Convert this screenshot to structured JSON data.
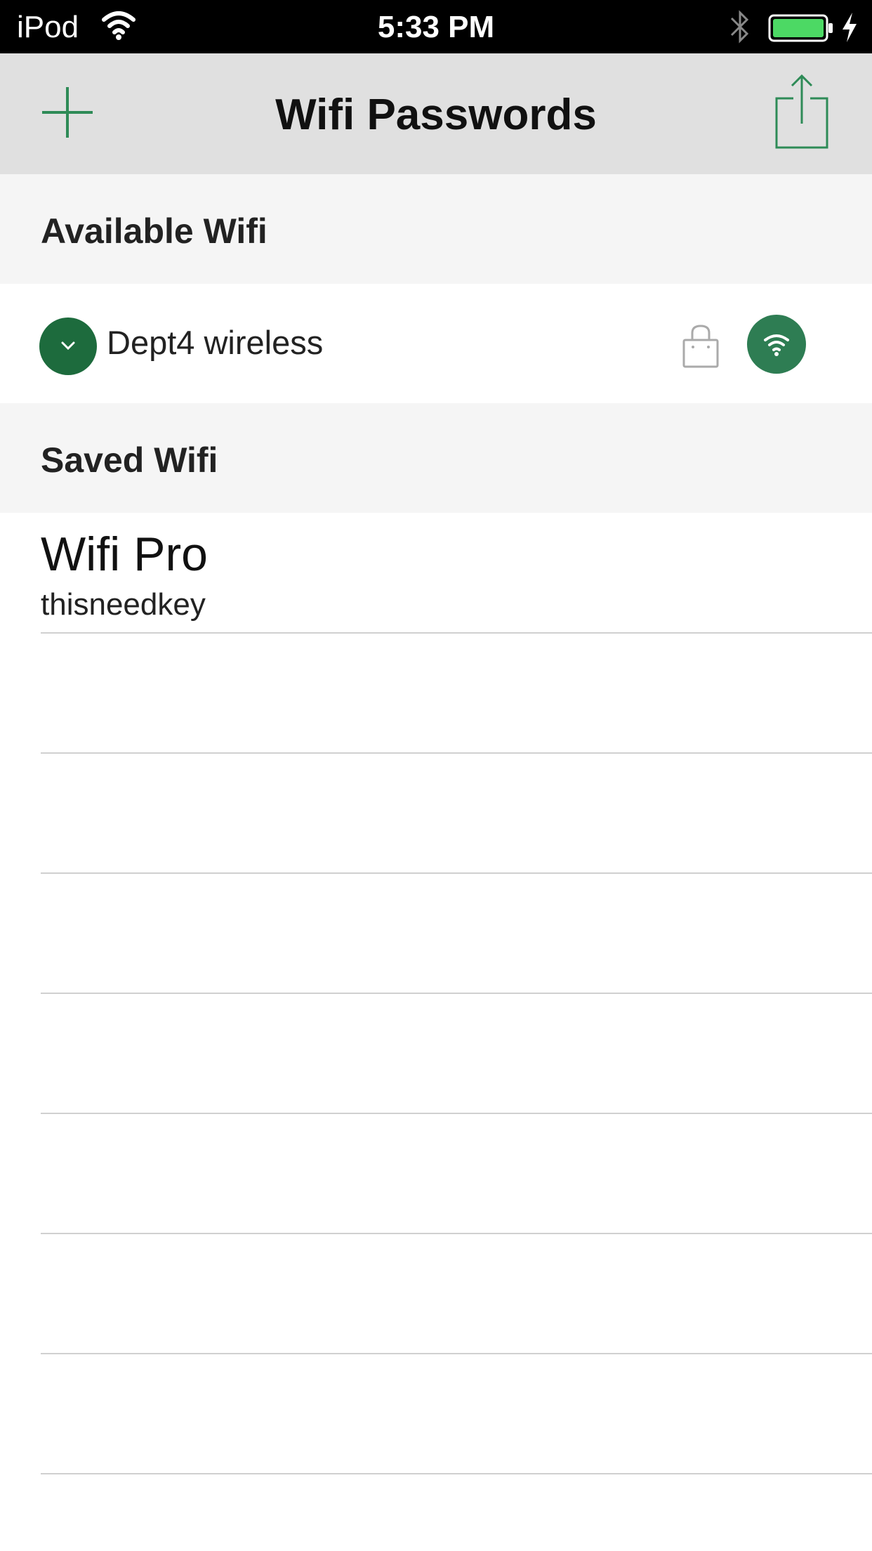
{
  "status_bar": {
    "carrier": "iPod",
    "time": "5:33 PM",
    "battery_color": "#4cd964"
  },
  "nav": {
    "title": "Wifi Passwords",
    "add_icon": "plus-icon",
    "share_icon": "share-icon",
    "accent_color": "#2e8b57"
  },
  "sections": {
    "available_title": "Available Wifi",
    "saved_title": "Saved Wifi"
  },
  "available": [
    {
      "name": "Dept4 wireless",
      "secured": true
    }
  ],
  "saved": [
    {
      "ssid": "Wifi Pro",
      "password": "thisneedkey"
    }
  ]
}
